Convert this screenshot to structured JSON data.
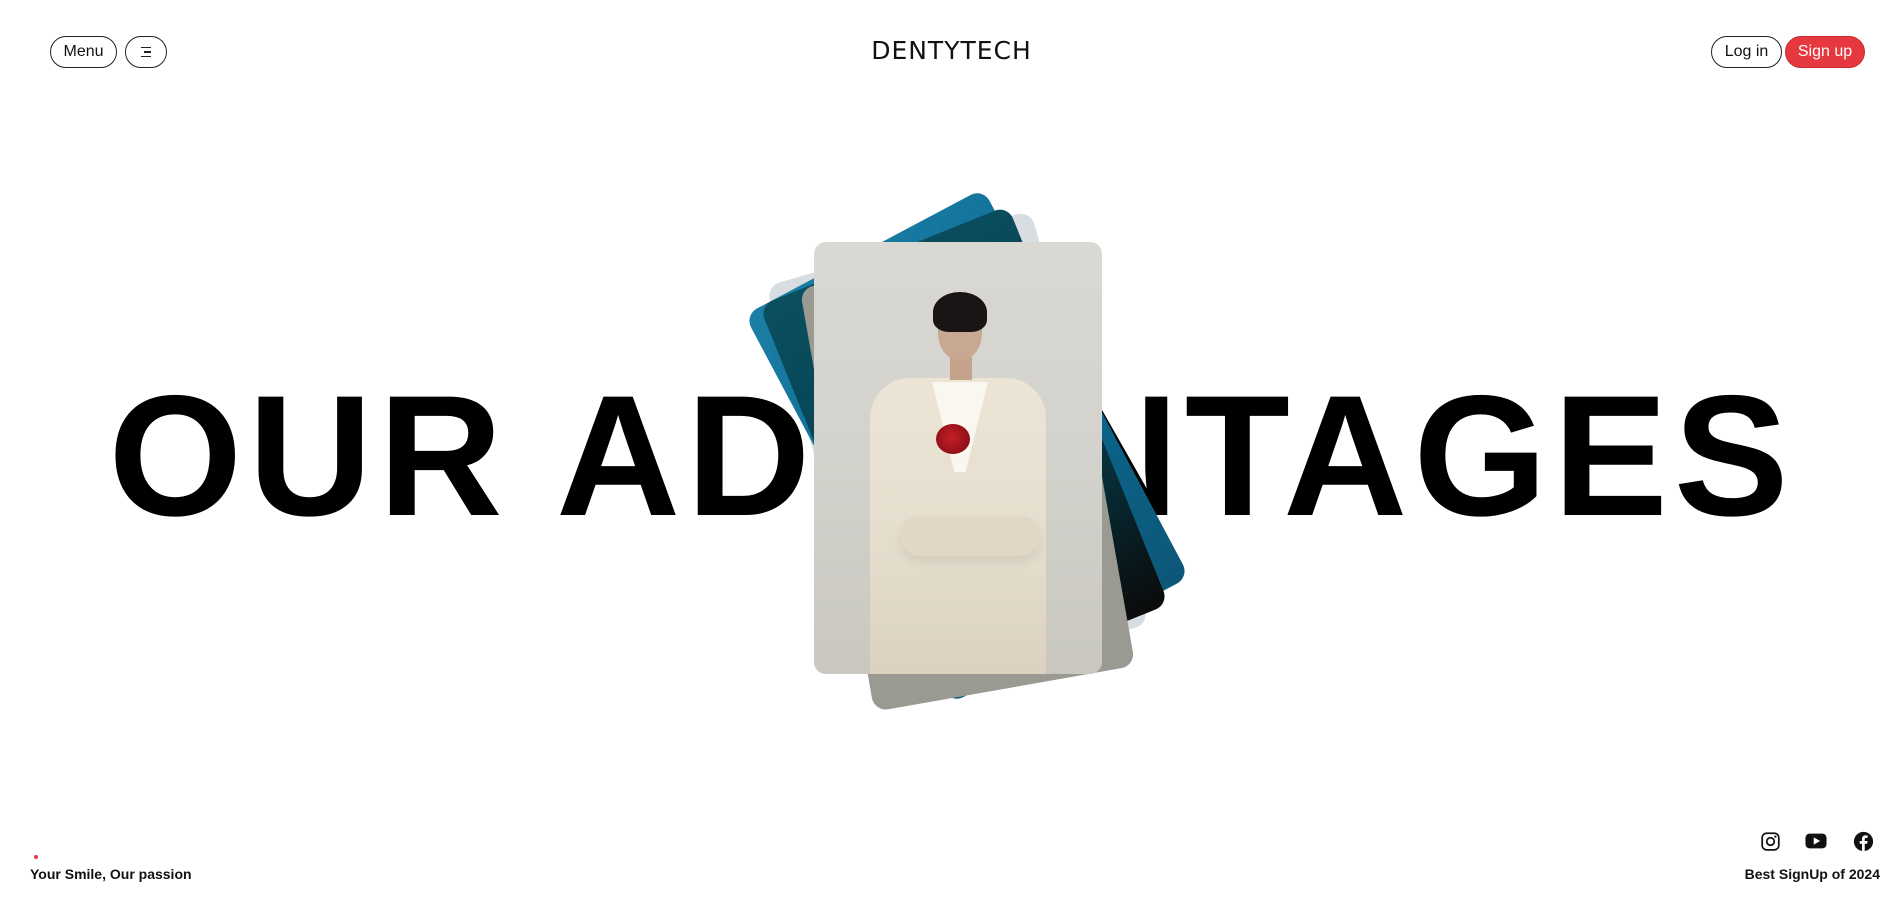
{
  "header": {
    "menu_label": "Menu",
    "menu_icon": "hamburger-icon",
    "brand": "DENTYTECH",
    "login_label": "Log in",
    "signup_label": "Sign up"
  },
  "hero": {
    "title": "OUR ADVANTAGES",
    "image_stack": [
      "teal-card",
      "dark-teal-card",
      "gray-card",
      "light-card",
      "woman-in-cream-suit-photo"
    ]
  },
  "footer": {
    "tagline": "Your Smile, Our passion",
    "right_text": "Best SignUp of 2024",
    "social_icons": [
      "instagram-icon",
      "youtube-icon",
      "facebook-icon"
    ]
  },
  "colors": {
    "accent": "#e5393f",
    "text": "#111111",
    "background": "#ffffff",
    "teal": "#0a6a92",
    "dark_teal": "#063e4d"
  }
}
